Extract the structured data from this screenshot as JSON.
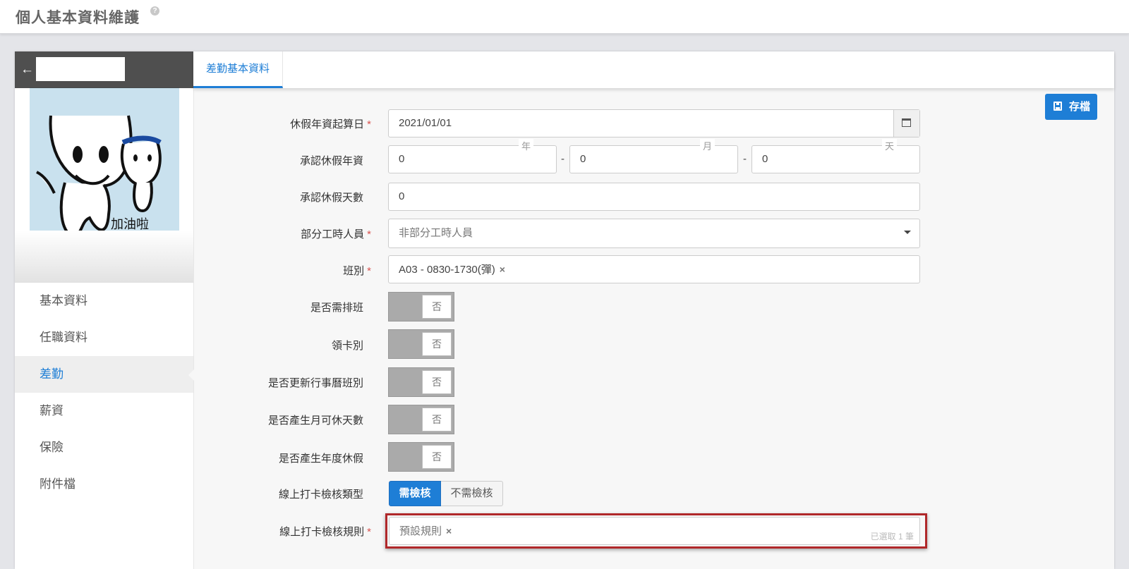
{
  "header": {
    "title": "個人基本資料維護",
    "help_icon": "help-icon"
  },
  "sidebar": {
    "back_icon": "arrow-left-icon",
    "avatar_caption": "加油啦",
    "items": [
      {
        "label": "基本資料"
      },
      {
        "label": "任職資料"
      },
      {
        "label": "差勤"
      },
      {
        "label": "薪資"
      },
      {
        "label": "保險"
      },
      {
        "label": "附件檔"
      }
    ],
    "active_index": 2
  },
  "tabs": [
    {
      "label": "差勤基本資料"
    }
  ],
  "toolbar": {
    "save_label": "存檔",
    "save_icon": "floppy-disk-icon"
  },
  "form": {
    "leave_start": {
      "label": "休假年資起算日",
      "value": "2021/01/01"
    },
    "approved_years": {
      "label": "承認休假年資",
      "year_legend": "年",
      "month_legend": "月",
      "day_legend": "天",
      "year": "0",
      "month": "0",
      "day": "0",
      "sep": "-"
    },
    "approved_days": {
      "label": "承認休假天數",
      "value": "0"
    },
    "part_time": {
      "label": "部分工時人員",
      "value": "非部分工時人員"
    },
    "shift": {
      "label": "班別",
      "value": "A03 - 0830-1730(彈)",
      "remove": "×"
    },
    "need_schedule": {
      "label": "是否需排班",
      "value": "否"
    },
    "card_type": {
      "label": "領卡別",
      "value": "否"
    },
    "update_calendar": {
      "label": "是否更新行事曆班別",
      "value": "否"
    },
    "monthly_days": {
      "label": "是否產生月可休天數",
      "value": "否"
    },
    "annual_leave": {
      "label": "是否產生年度休假",
      "value": "否"
    },
    "check_type": {
      "label": "線上打卡檢核類型",
      "options": [
        "需檢核",
        "不需檢核"
      ],
      "selected": "需檢核"
    },
    "check_rule": {
      "label": "線上打卡檢核規則",
      "value": "預設規則",
      "remove": "×",
      "count": "已選取 1 筆"
    }
  },
  "colors": {
    "accent": "#1e7ed6",
    "required": "#d9534f",
    "highlight": "#b0282a"
  }
}
